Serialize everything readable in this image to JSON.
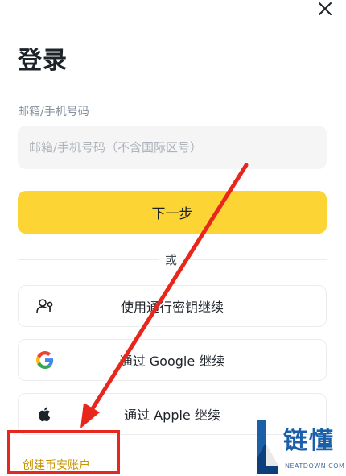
{
  "header": {
    "title": "登录"
  },
  "form": {
    "email_label": "邮箱/手机号码",
    "email_placeholder": "邮箱/手机号码（不含国际区号）",
    "email_value": "",
    "next_label": "下一步"
  },
  "divider_text": "或",
  "options": [
    {
      "label": "使用通行密钥继续",
      "icon": "passkey-icon"
    },
    {
      "label": "通过 Google 继续",
      "icon": "google-icon"
    },
    {
      "label": "通过 Apple 继续",
      "icon": "apple-icon"
    }
  ],
  "create_account_label": "创建币安账户",
  "watermark": {
    "main": "链懂",
    "sub": "NEATDOWN.COM"
  },
  "colors": {
    "accent": "#fcd535",
    "link": "#c99400",
    "annotation": "#e8261c"
  }
}
